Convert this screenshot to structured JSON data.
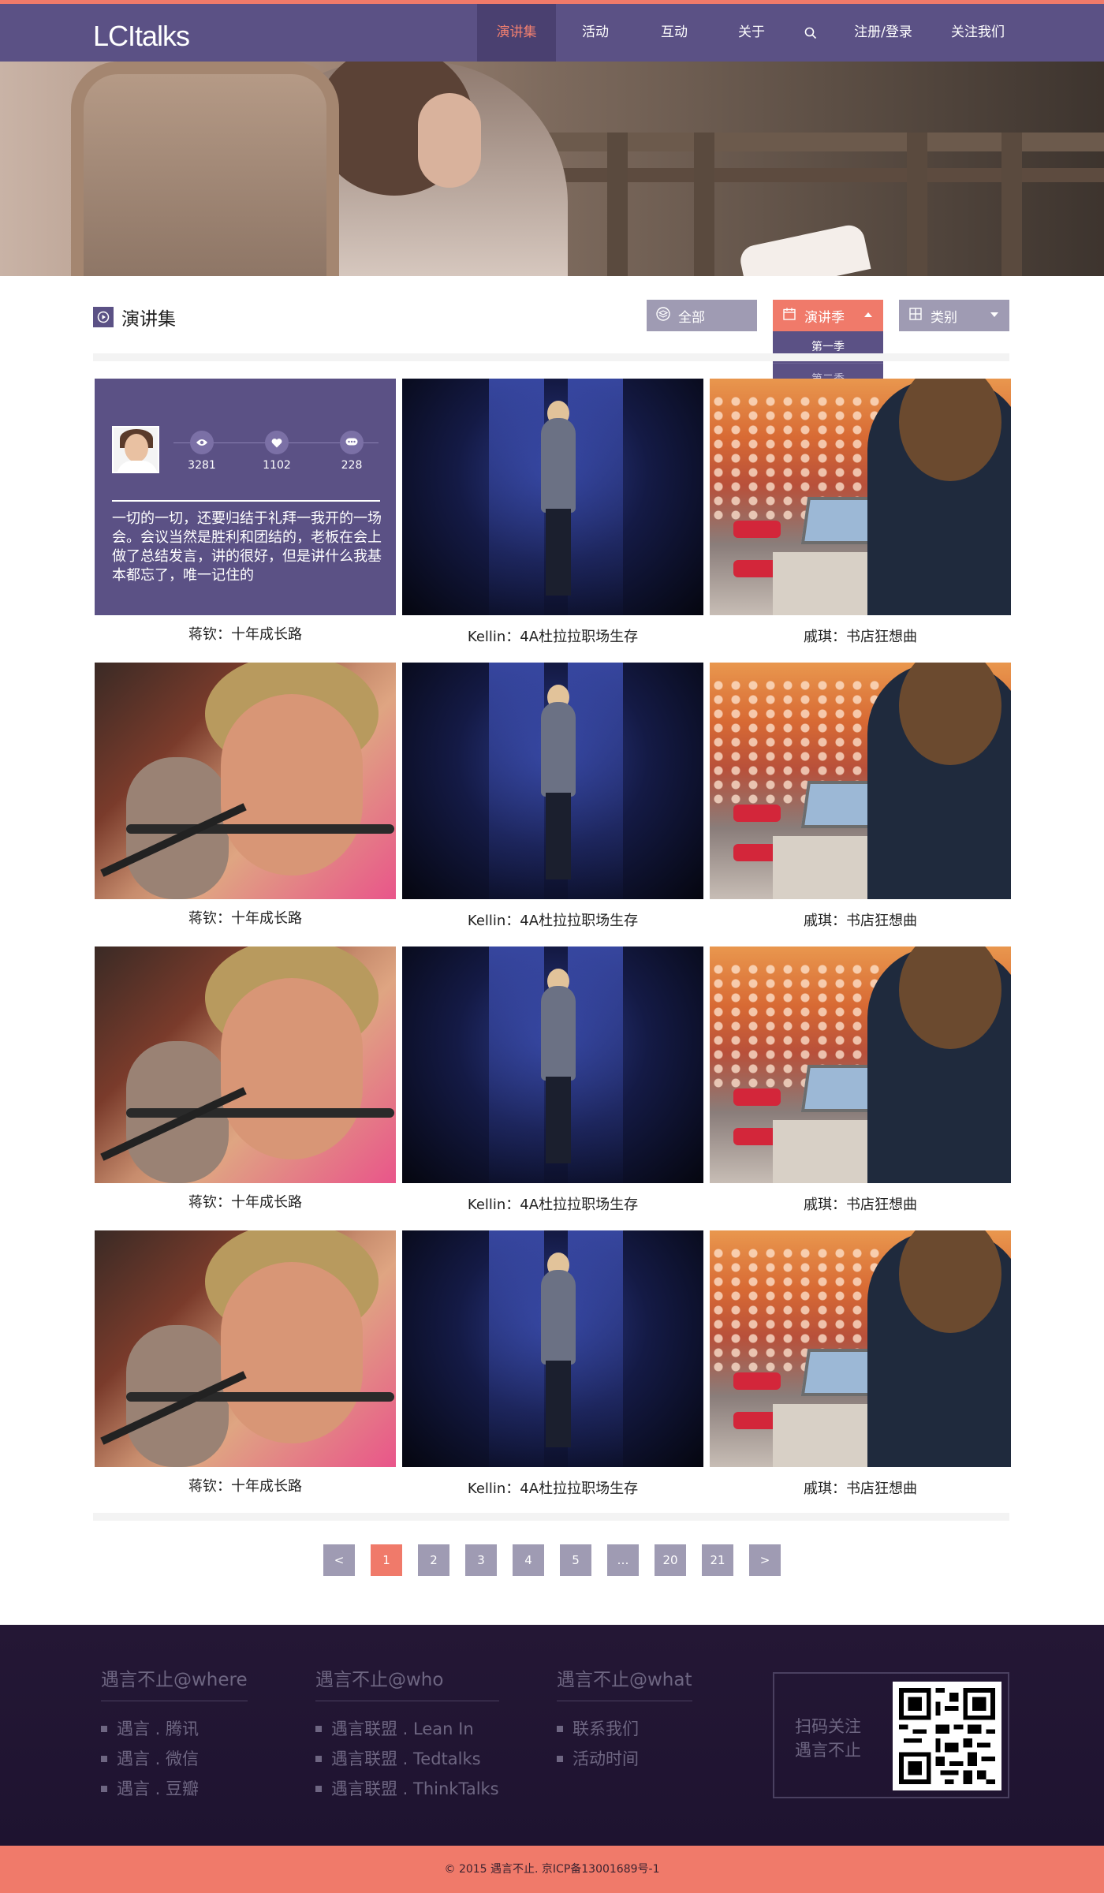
{
  "brand": {
    "logo": "LCItalks",
    "accent": "#f07a6a",
    "primary": "#5b5185"
  },
  "nav": {
    "items": [
      "演讲集",
      "活动",
      "互动",
      "关于"
    ],
    "active_index": 0,
    "search_icon": "search-icon",
    "register_login": "注册/登录",
    "follow": "关注我们"
  },
  "section": {
    "icon": "play-circle-icon",
    "title": "演讲集"
  },
  "filters": {
    "all": {
      "label": "全部",
      "icon": "layers-icon"
    },
    "season": {
      "label": "演讲季",
      "icon": "calendar-icon",
      "open": true,
      "options": [
        "第一季",
        "第二季"
      ]
    },
    "category": {
      "label": "类别",
      "icon": "grid-icon"
    }
  },
  "featured": {
    "views": "3281",
    "likes": "1102",
    "comments": "228",
    "blurb": "一切的一切，还要归结于礼拜一我开的一场会。会议当然是胜利和团结的，老板在会上做了总结发言，讲的很好，但是讲什么我基本都忘了，唯一记住的"
  },
  "talks": [
    [
      "蒋钦：十年成长路",
      "Kellin：4A杜拉拉职场生存",
      "戚琪：书店狂想曲"
    ],
    [
      "蒋钦：十年成长路",
      "Kellin：4A杜拉拉职场生存",
      "戚琪：书店狂想曲"
    ],
    [
      "蒋钦：十年成长路",
      "Kellin：4A杜拉拉职场生存",
      "戚琪：书店狂想曲"
    ],
    [
      "蒋钦：十年成长路",
      "Kellin：4A杜拉拉职场生存",
      "戚琪：书店狂想曲"
    ]
  ],
  "pagination": {
    "prev": "<",
    "pages": [
      "1",
      "2",
      "3",
      "4",
      "5",
      "…",
      "20",
      "21"
    ],
    "active": "1",
    "next": ">"
  },
  "footer": {
    "columns": [
      {
        "heading": "遇言不止@where",
        "items": [
          "遇言 . 腾讯",
          "遇言 . 微信",
          "遇言 . 豆瓣"
        ]
      },
      {
        "heading": "遇言不止@who",
        "items": [
          "遇言联盟 . Lean In",
          "遇言联盟 . Tedtalks",
          "遇言联盟 . ThinkTalks"
        ]
      },
      {
        "heading": "遇言不止@what",
        "items": [
          "联系我们",
          "活动时间"
        ]
      }
    ],
    "qr_text": "扫码关注遇言不止",
    "copyright": "© 2015 遇言不止. 京ICP备13001689号-1"
  }
}
